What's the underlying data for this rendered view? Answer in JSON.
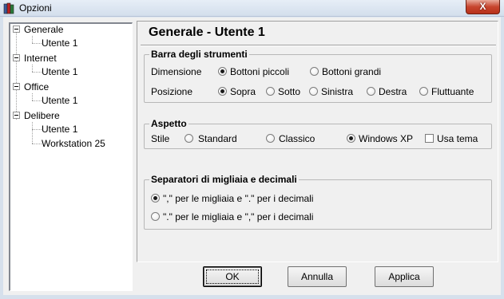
{
  "window": {
    "title": "Opzioni",
    "icon": "book-stack-icon",
    "close_label": "X"
  },
  "tree": {
    "nodes": [
      {
        "label": "Generale",
        "expanded": true,
        "children": [
          "Utente  1"
        ]
      },
      {
        "label": "Internet",
        "expanded": true,
        "children": [
          "Utente  1"
        ]
      },
      {
        "label": "Office",
        "expanded": true,
        "children": [
          "Utente  1"
        ]
      },
      {
        "label": "Delibere",
        "expanded": true,
        "children": [
          "Utente  1",
          "Workstation 25"
        ]
      }
    ]
  },
  "pane": {
    "title": "Generale - Utente  1"
  },
  "toolbar_group": {
    "title": "Barra degli strumenti",
    "dimension_label": "Dimensione",
    "dimension_options": [
      {
        "label": "Bottoni piccoli",
        "selected": true
      },
      {
        "label": "Bottoni grandi",
        "selected": false
      }
    ],
    "position_label": "Posizione",
    "position_options": [
      {
        "label": "Sopra",
        "selected": true
      },
      {
        "label": "Sotto",
        "selected": false
      },
      {
        "label": "Sinistra",
        "selected": false
      },
      {
        "label": "Destra",
        "selected": false
      },
      {
        "label": "Fluttuante",
        "selected": false
      }
    ]
  },
  "appearance_group": {
    "title": "Aspetto",
    "style_label": "Stile",
    "style_options": [
      {
        "label": "Standard",
        "selected": false
      },
      {
        "label": "Classico",
        "selected": false
      },
      {
        "label": "Windows XP",
        "selected": true
      }
    ],
    "use_theme_label": "Usa tema",
    "use_theme_checked": false
  },
  "separators_group": {
    "title": "Separatori di migliaia e decimali",
    "options": [
      {
        "label": "\",\" per le migliaia e \".\" per i decimali",
        "selected": true
      },
      {
        "label": "\".\" per le migliaia e \",\" per i decimali",
        "selected": false
      }
    ]
  },
  "buttons": {
    "ok": "OK",
    "cancel": "Annulla",
    "apply": "Applica"
  }
}
